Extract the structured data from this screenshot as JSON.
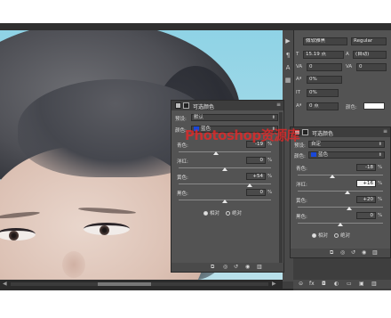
{
  "watermark": "Photoshop资源库",
  "character_panel": {
    "font_family": "微软雅黑",
    "font_style": "Regular",
    "font_size": "15.19 点",
    "leading": "(自动)",
    "kerning": "0",
    "tracking": "0%",
    "scale": "0 点",
    "color_label": "颜色:"
  },
  "left_properties": {
    "title": "可选颜色",
    "preset_label": "预设:",
    "preset_value": "默认",
    "colors_label": "颜色:",
    "colors_value": "蓝色",
    "sliders": [
      {
        "label": "青色:",
        "value": "-19",
        "unit": "%",
        "level": 0.405
      },
      {
        "label": "洋红:",
        "value": "0",
        "unit": "%",
        "level": 0.5
      },
      {
        "label": "黄色:",
        "value": "+54",
        "unit": "%",
        "level": 0.77
      },
      {
        "label": "黑色:",
        "value": "0",
        "unit": "%",
        "level": 0.5
      }
    ],
    "radio_relative": "相对",
    "radio_absolute": "绝对"
  },
  "right_properties": {
    "title": "可选颜色",
    "preset_label": "预设:",
    "preset_value": "自定",
    "colors_label": "颜色:",
    "colors_value": "蓝色",
    "sliders": [
      {
        "label": "青色:",
        "value": "-18",
        "unit": "%",
        "level": 0.41
      },
      {
        "label": "洋红:",
        "value": "+16",
        "unit": "%",
        "level": 0.58
      },
      {
        "label": "黄色:",
        "value": "+20",
        "unit": "%",
        "level": 0.6
      },
      {
        "label": "黑色:",
        "value": "0",
        "unit": "%",
        "level": 0.5
      }
    ],
    "radio_relative": "相对",
    "radio_absolute": "绝对"
  },
  "colors": {
    "panel": "#535353",
    "panel_dark": "#3d3d3d",
    "blue_chip": "#1947d8",
    "watermark": "#e62828"
  }
}
